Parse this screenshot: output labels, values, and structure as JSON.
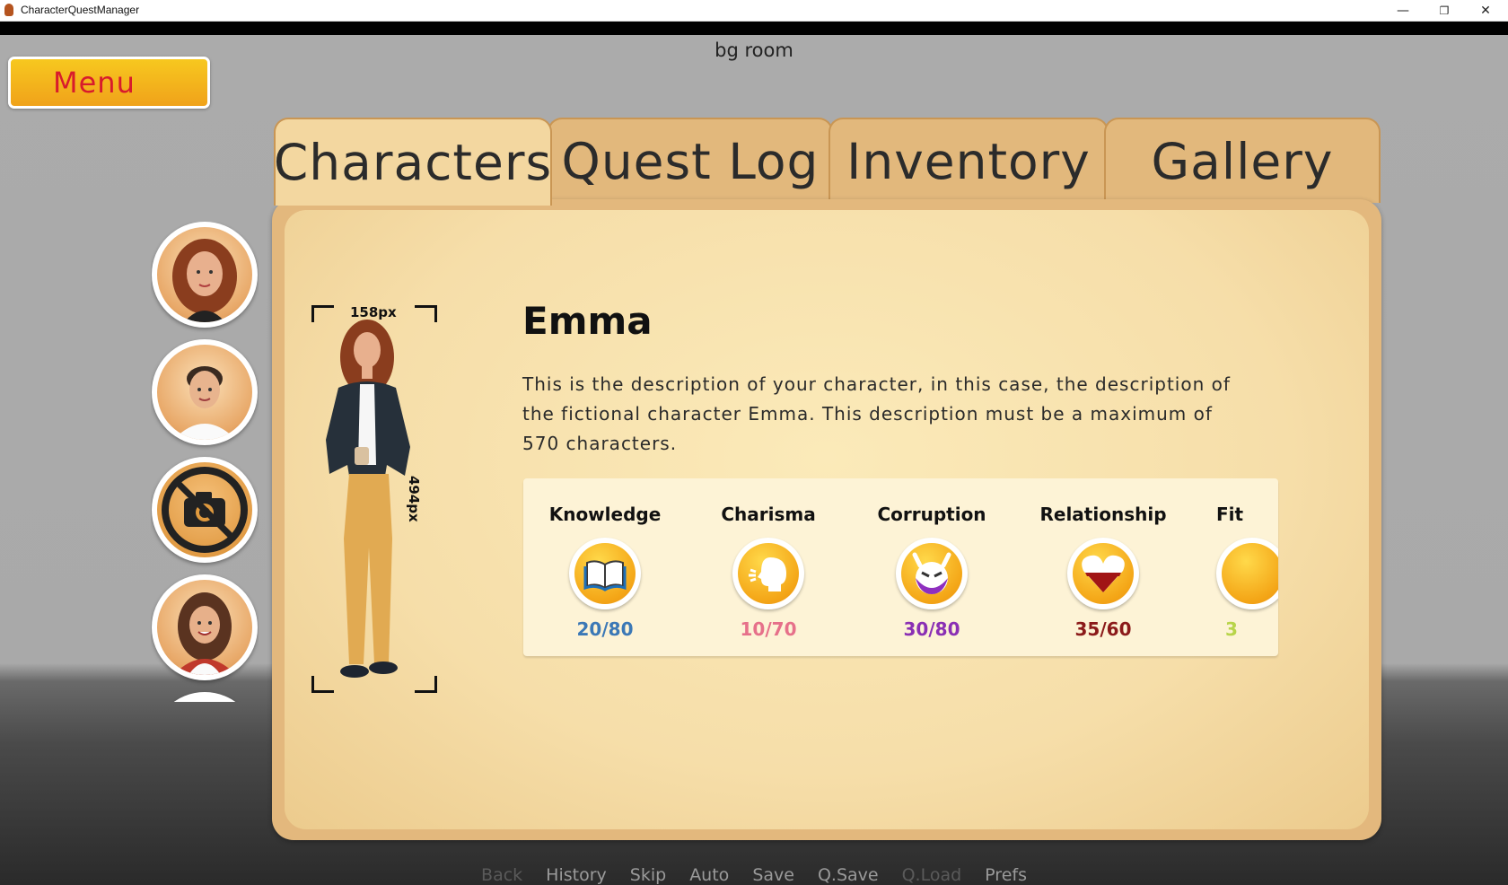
{
  "window": {
    "title": "CharacterQuestManager",
    "controls": [
      "—",
      "❐",
      "✕"
    ]
  },
  "scene": {
    "label": "bg room"
  },
  "menu_button": {
    "label": "Menu"
  },
  "tabs": [
    {
      "label": "Characters",
      "active": true
    },
    {
      "label": "Quest Log",
      "active": false
    },
    {
      "label": "Inventory",
      "active": false
    },
    {
      "label": "Gallery",
      "active": false
    }
  ],
  "avatars": [
    {
      "name": "emma",
      "selected": true
    },
    {
      "name": "young-man"
    },
    {
      "name": "locked-camera"
    },
    {
      "name": "smiling-woman"
    }
  ],
  "character": {
    "name": "Emma",
    "description": "This is the description of your character, in this case, the description of the fictional character Emma. This description must be a maximum of 570 characters.",
    "portrait_width_label": "158px",
    "portrait_height_label": "494px"
  },
  "stats": [
    {
      "label": "Knowledge",
      "value": "20/80",
      "icon": "book-icon",
      "color": "#3b78b6"
    },
    {
      "label": "Charisma",
      "value": "10/70",
      "icon": "speaking-head-icon",
      "color": "#e6708a"
    },
    {
      "label": "Corruption",
      "value": "30/80",
      "icon": "devil-face-icon",
      "color": "#8a2fb4"
    },
    {
      "label": "Relationship",
      "value": "35/60",
      "icon": "heart-icon",
      "color": "#8b1a1a"
    },
    {
      "label": "Fit",
      "value": "3",
      "icon": "fitness-icon",
      "color": "#b8d44a"
    }
  ],
  "quick_menu": [
    {
      "label": "Back",
      "enabled": false
    },
    {
      "label": "History",
      "enabled": true
    },
    {
      "label": "Skip",
      "enabled": true
    },
    {
      "label": "Auto",
      "enabled": true
    },
    {
      "label": "Save",
      "enabled": true
    },
    {
      "label": "Q.Save",
      "enabled": true
    },
    {
      "label": "Q.Load",
      "enabled": false
    },
    {
      "label": "Prefs",
      "enabled": true
    }
  ]
}
